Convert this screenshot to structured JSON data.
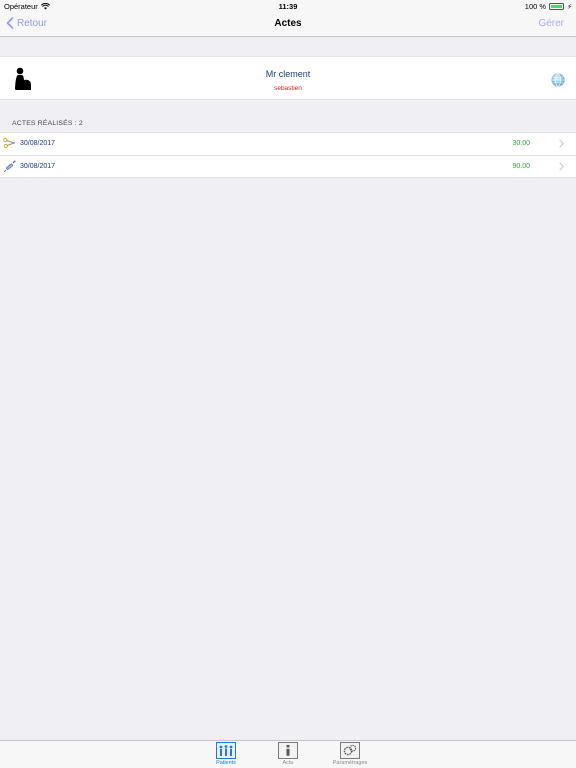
{
  "status_bar": {
    "carrier": "Opérateur",
    "time": "11:39",
    "battery": "100 %"
  },
  "nav": {
    "back_label": "Retour",
    "title": "Actes",
    "manage_label": "Gérer"
  },
  "patient": {
    "name": "Mr clement",
    "firstname": "sebastien"
  },
  "acts_section": {
    "header": "ACTES RÉALISÉS : 2",
    "items": [
      {
        "date": "30/08/2017",
        "amount": "30.00",
        "icon": "scissors-icon"
      },
      {
        "date": "30/08/2017",
        "amount": "90.00",
        "icon": "syringe-icon"
      }
    ]
  },
  "tabs": [
    {
      "label": "Patients",
      "icon": "patients-icon",
      "active": true
    },
    {
      "label": "Actu",
      "icon": "info-icon",
      "active": false
    },
    {
      "label": "Paramétrages",
      "icon": "settings-icon",
      "active": false
    }
  ],
  "colors": {
    "accent": "#1a7be2",
    "nav_link": "#8e9cf0",
    "amount": "#2faa3b",
    "firstname": "#e61c1c",
    "text_blue": "#1d3d7a"
  }
}
